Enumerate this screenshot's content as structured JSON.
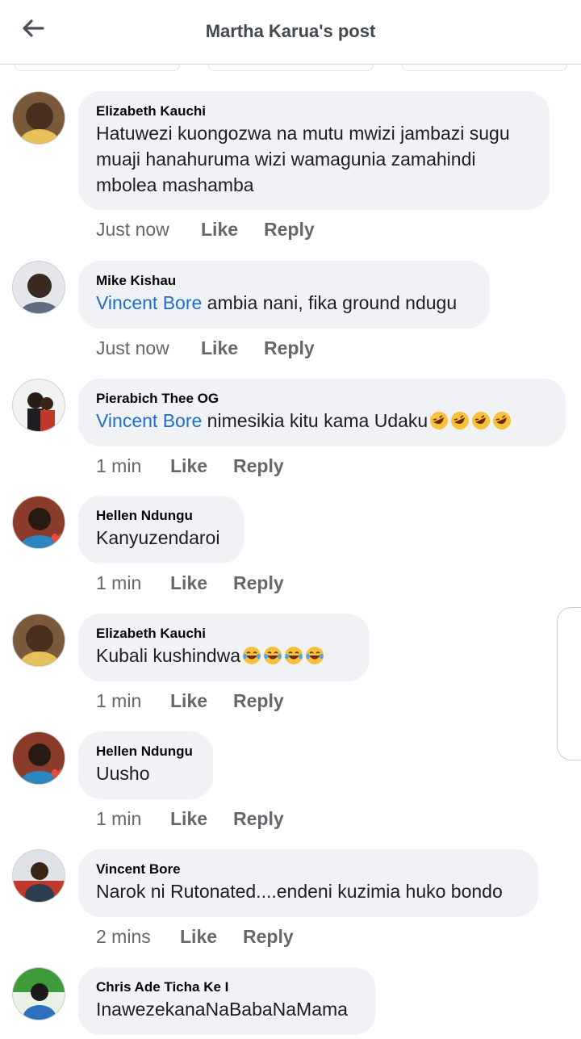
{
  "header": {
    "title": "Martha Karua's post",
    "back_icon": "arrow-left-icon"
  },
  "comments": [
    {
      "author": "Elizabeth Kauchi",
      "mention": "",
      "text": "Hatuwezi kuongozwa na mutu mwizi jambazi sugu muaji hanahuruma wizi wamagunia zamahindi mbolea mashamba",
      "time": "Just now",
      "like": "Like",
      "reply": "Reply",
      "avatar_colors": [
        "#7a5a3a",
        "#e7c25a"
      ]
    },
    {
      "author": "Mike Kishau",
      "mention": "Vincent Bore",
      "text": " ambia nani, fika ground ndugu",
      "time": "Just now",
      "like": "Like",
      "reply": "Reply",
      "avatar_colors": [
        "#e5e7ea",
        "#3b2a22"
      ]
    },
    {
      "author": "Pierabich Thee OG",
      "mention": "Vincent Bore",
      "text": " nimesikia kitu kama Udaku",
      "emoji": "rolling-laughing-emoji",
      "emoji_count": 4,
      "time": "1 min",
      "like": "Like",
      "reply": "Reply",
      "avatar_colors": [
        "#f2f2f2",
        "#1e1e22"
      ]
    },
    {
      "author": "Hellen Ndungu",
      "mention": "",
      "text": "Kanyuzendaroi",
      "time": "1 min",
      "like": "Like",
      "reply": "Reply",
      "avatar_colors": [
        "#8b3b2a",
        "#2a1a14"
      ]
    },
    {
      "author": "Elizabeth Kauchi",
      "mention": "",
      "text": "Kubali kushindwa",
      "emoji": "tears-of-joy-emoji",
      "emoji_count": 4,
      "time": "1 min",
      "like": "Like",
      "reply": "Reply",
      "avatar_colors": [
        "#7a5a3a",
        "#e7c25a"
      ]
    },
    {
      "author": "Hellen Ndungu",
      "mention": "",
      "text": "Uusho",
      "time": "1 min",
      "like": "Like",
      "reply": "Reply",
      "avatar_colors": [
        "#8b3b2a",
        "#2a1a14"
      ]
    },
    {
      "author": "Vincent Bore",
      "mention": "",
      "text": "Narok ni Rutonated....endeni kuzimia huko bondo",
      "time": "2 mins",
      "like": "Like",
      "reply": "Reply",
      "avatar_colors": [
        "#c0392b",
        "#2c3e50"
      ]
    },
    {
      "author": "Chris Ade Ticha Ke I",
      "mention": "",
      "text": "InawezekanaNaBabaNaMama",
      "time": "",
      "like": "",
      "reply": "",
      "avatar_colors": [
        "#3f9a3a",
        "#1b1b1b"
      ]
    }
  ],
  "colors": {
    "bubble": "#f0f2f5",
    "mention": "#1a6fd1",
    "secondary_text": "#65676b"
  }
}
